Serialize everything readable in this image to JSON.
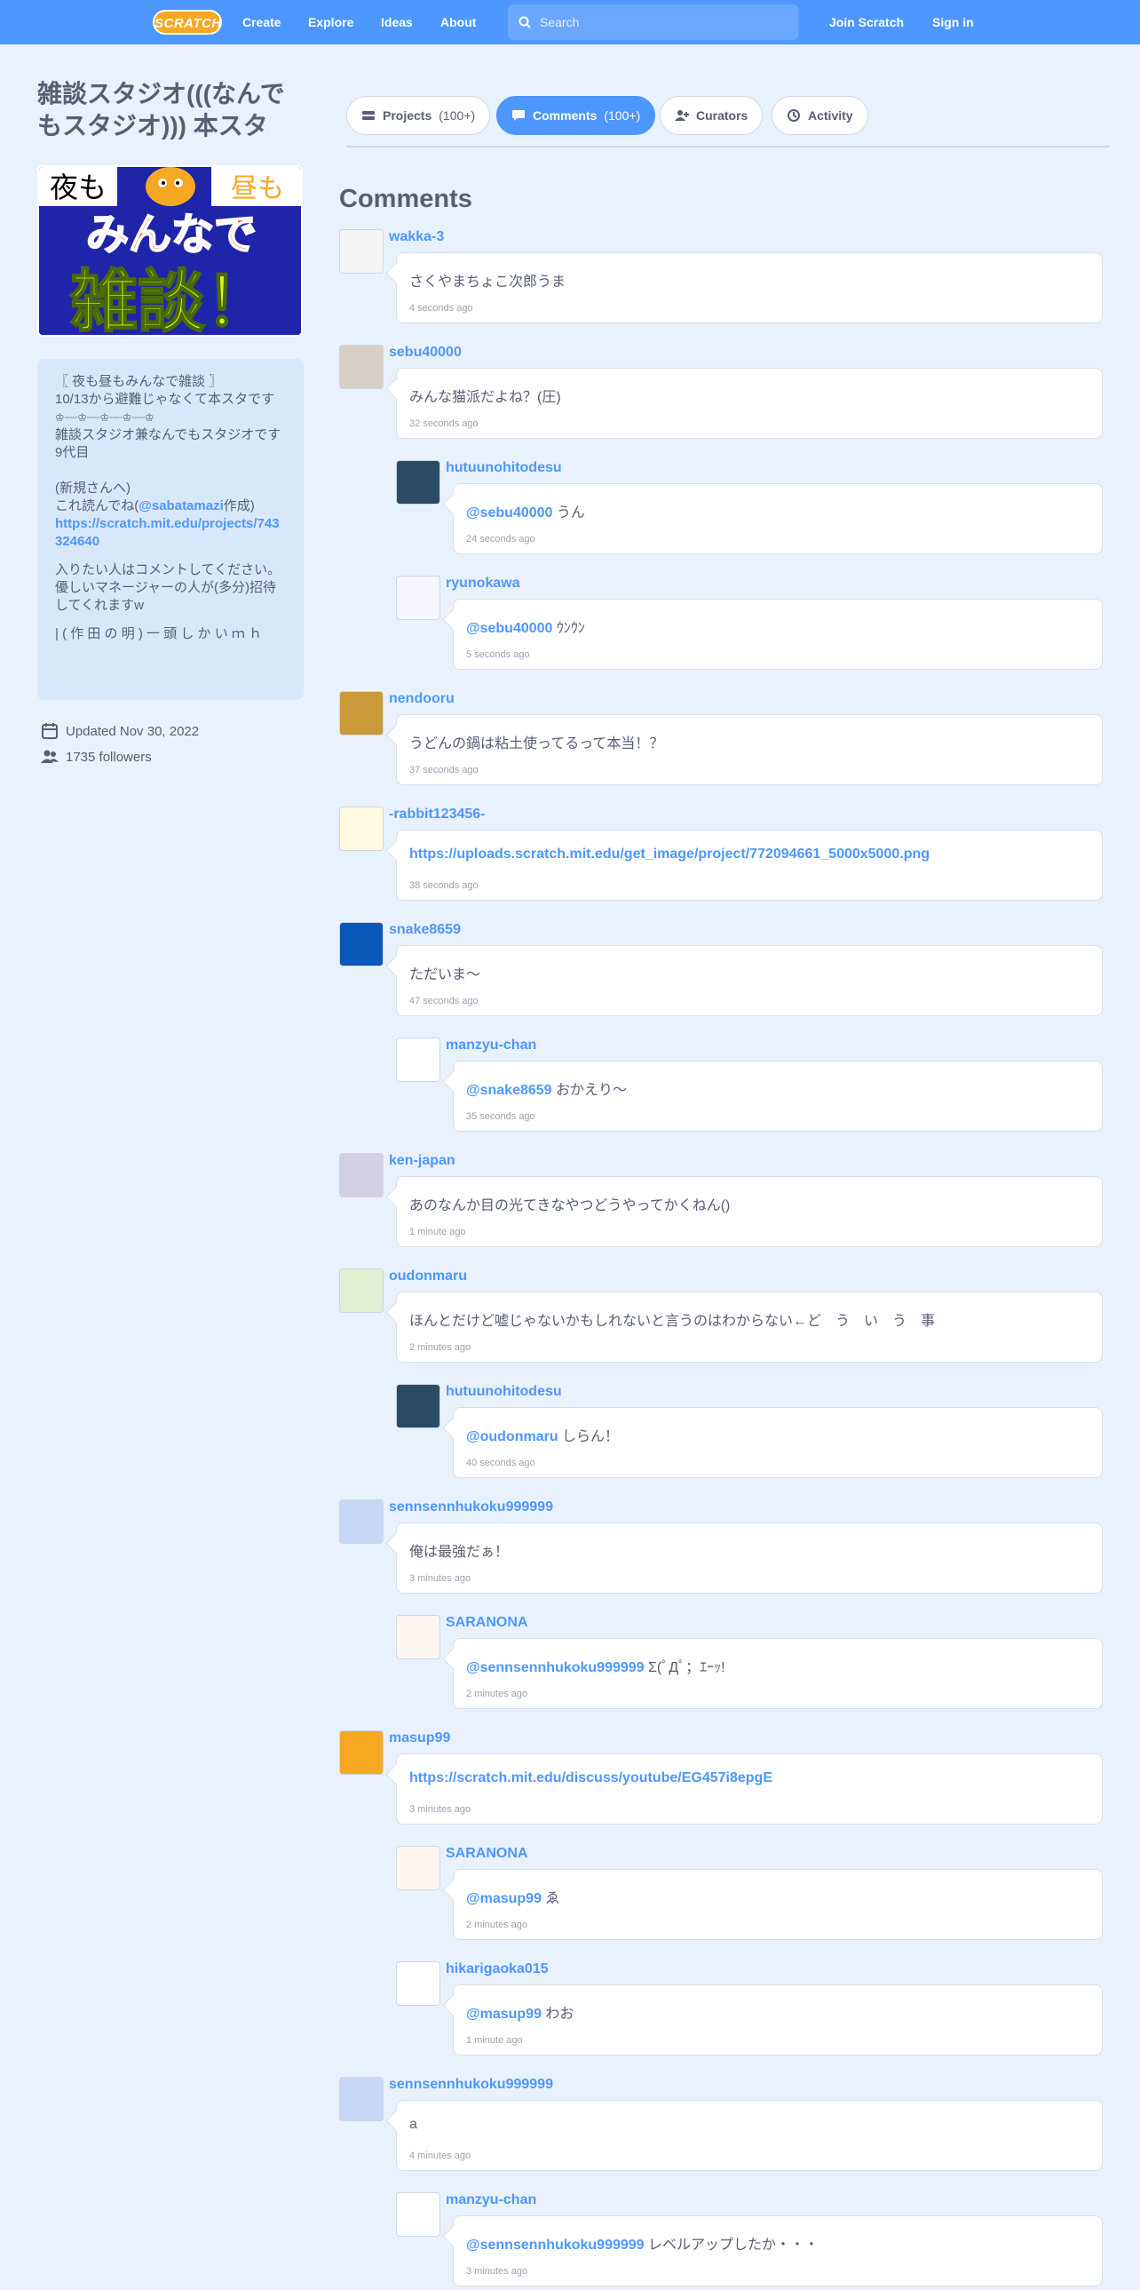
{
  "nav": {
    "logo": "SCRATCH",
    "links": [
      "Create",
      "Explore",
      "Ideas",
      "About"
    ],
    "search_placeholder": "Search",
    "join": "Join Scratch",
    "signin": "Sign in"
  },
  "studio": {
    "title": "雑談スタジオ(((なんでもスタジオ))) 本スタ",
    "thumb_text": {
      "night": "夜も",
      "day": "昼も",
      "everyone": "みんなで",
      "chat": "雑談！"
    },
    "description": [
      "〖 夜も昼もみんなで雑談 〗",
      "10/13から避難じゃなくて本スタです",
      "♔┈┈♔┈┈♔┈┈♔┈┈♔",
      "雑談スタジオ兼なんでもスタジオです",
      "9代目",
      "",
      "(新規さんへ)"
    ],
    "desc_link_line_prefix": "これ読んでね(",
    "desc_link_user": "@sabatamazi",
    "desc_link_line_suffix": "作成)",
    "desc_url": "https://scratch.mit.edu/projects/743324640",
    "desc_after": [
      "入りたい人はコメントしてください。",
      "優しいマネージャーの人が(多分)招待してくれますw"
    ],
    "desc_cutoff": "| ( 作 田 の 明 ) 一 頭 し か い ｍ ｈ",
    "updated": "Updated Nov 30, 2022",
    "followers": "1735 followers"
  },
  "tabs": [
    {
      "label": "Projects",
      "count": "(100+)"
    },
    {
      "label": "Comments",
      "count": "(100+)"
    },
    {
      "label": "Curators",
      "count": ""
    },
    {
      "label": "Activity",
      "count": ""
    }
  ],
  "comments_heading": "Comments",
  "comments": [
    {
      "user": "wakka-3",
      "mention": "",
      "text": "さくやまちょこ次郎うま",
      "time": "4 seconds ago"
    },
    {
      "user": "sebu40000",
      "mention": "",
      "text": "みんな猫派だよね？(圧)",
      "time": "32 seconds ago"
    },
    {
      "user": "hutuunohitodesu",
      "mention": "@sebu40000",
      "text": " うん",
      "time": "24 seconds ago"
    },
    {
      "user": "ryunokawa",
      "mention": "@sebu40000",
      "text": " ｳﾝｳﾝ",
      "time": "5 seconds ago"
    },
    {
      "user": "nendooru",
      "mention": "",
      "text": "うどんの鍋は粘土使ってるって本当！？",
      "time": "37 seconds ago"
    },
    {
      "user": "-rabbit123456-",
      "mention": "https://uploads.scratch.mit.edu/get_image/project/772094661_5000x5000.png",
      "text": "",
      "time": "38 seconds ago"
    },
    {
      "user": "snake8659",
      "mention": "",
      "text": "ただいま～",
      "time": "47 seconds ago"
    },
    {
      "user": "manzyu-chan",
      "mention": "@snake8659",
      "text": " おかえり～",
      "time": "35 seconds ago"
    },
    {
      "user": "ken-japan",
      "mention": "",
      "text": "あのなんか目の光てきなやつどうやってかくねん()",
      "time": "1 minute ago"
    },
    {
      "user": "oudonmaru",
      "mention": "",
      "text": "ほんとだけど嘘じゃないかもしれないと言うのはわからない←ど　う　い　う　事",
      "time": "2 minutes ago"
    },
    {
      "user": "hutuunohitodesu",
      "mention": "@oudonmaru",
      "text": " しらん！",
      "time": "40 seconds ago"
    },
    {
      "user": "sennsennhukoku999999",
      "mention": "",
      "text": "俺は最強だぁ！",
      "time": "3 minutes ago"
    },
    {
      "user": "SARANONA",
      "mention": "@sennsennhukoku999999",
      "text": " Σ(ﾟДﾟ；ｴｰｯ!",
      "time": "2 minutes ago"
    },
    {
      "user": "masup99",
      "mention": "https://scratch.mit.edu/discuss/youtube/EG457i8epgE",
      "text": "",
      "time": "3 minutes ago"
    },
    {
      "user": "SARANONA",
      "mention": "@masup99",
      "text": " ゑ",
      "time": "2 minutes ago"
    },
    {
      "user": "hikarigaoka015",
      "mention": "@masup99",
      "text": " わお",
      "time": "1 minute ago"
    },
    {
      "user": "sennsennhukoku999999",
      "mention": "",
      "text": "a",
      "time": "4 minutes ago"
    },
    {
      "user": "manzyu-chan",
      "mention": "@sennsennhukoku999999",
      "text": " レベルアップしたか・・・",
      "time": "3 minutes ago"
    }
  ],
  "colors": {
    "brand": "#4d97ff",
    "background": "#e9f1fc",
    "text": "#575e75",
    "logo": "#f7a823"
  }
}
